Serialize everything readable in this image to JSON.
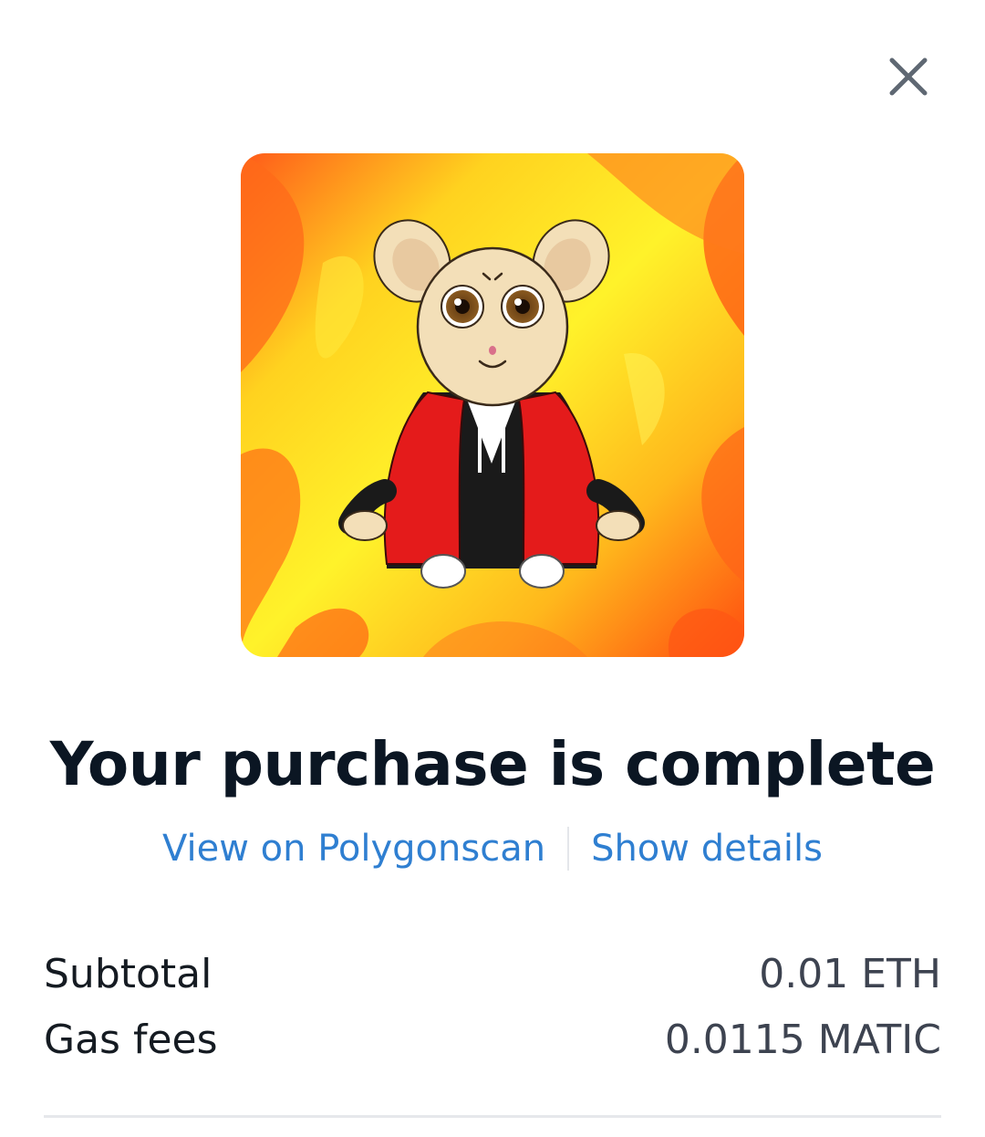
{
  "close_icon": "close-icon",
  "nft": {
    "art": "nft-artwork"
  },
  "title": "Your purchase is complete",
  "links": {
    "explorer": "View on Polygonscan",
    "details": "Show details"
  },
  "summary": {
    "subtotal_label": "Subtotal",
    "subtotal_value": "0.01 ETH",
    "gas_label": "Gas fees",
    "gas_value": "0.0115 MATIC"
  },
  "colors": {
    "link": "#2f7fd1",
    "title": "#0b1623",
    "close": "#5f6873",
    "divider": "#e6e8eb"
  }
}
